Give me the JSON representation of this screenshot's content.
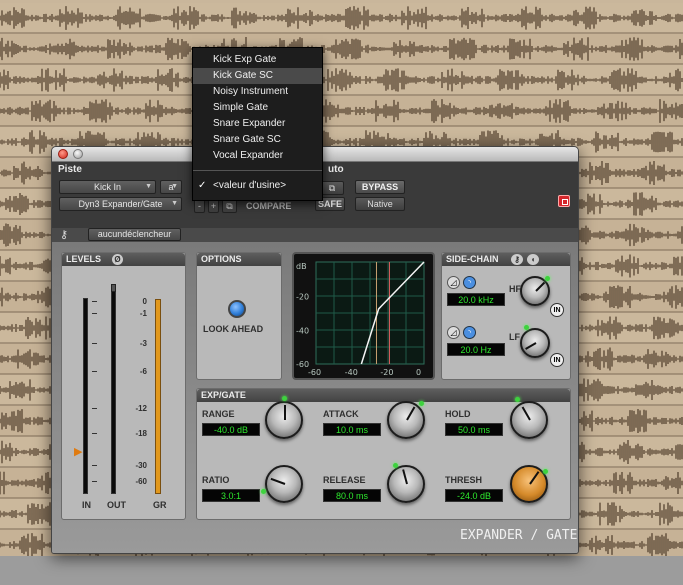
{
  "menu": {
    "items": [
      "Kick Exp Gate",
      "Kick Gate SC",
      "Noisy Instrument",
      "Simple Gate",
      "Snare Expander",
      "Snare Gate SC",
      "Vocal Expander"
    ],
    "highlighted_index": 1,
    "factory_default": "<valeur d'usine>",
    "checkmark": "✓"
  },
  "header": {
    "track_label": "Piste",
    "auto_label": "uto",
    "track_name": "Kick In",
    "track_channel": "a",
    "plugin_name": "Dyn3 Expander/Gate",
    "compare_label": "COMPARE",
    "safe_label": "SAFE",
    "bypass_label": "BYPASS",
    "native_label": "Native",
    "minus_label": "-",
    "plus_label": "+",
    "key_input": "aucundéclencheur"
  },
  "levels": {
    "title": "LEVELS",
    "scale": [
      "0",
      "-1",
      "-3",
      "-6",
      "-12",
      "-18",
      "-30",
      "-60"
    ],
    "in_label": "IN",
    "out_label": "OUT",
    "gr_label": "GR"
  },
  "options": {
    "title": "OPTIONS",
    "look_ahead_label": "LOOK AHEAD"
  },
  "graph": {
    "y_ticks": [
      "dB",
      "-20",
      "-40",
      "-60"
    ],
    "x_ticks": [
      "-60",
      "-40",
      "-20",
      "0"
    ]
  },
  "sidechain": {
    "title": "SIDE-CHAIN",
    "hf_label": "HF",
    "hf_value": "20.0 kHz",
    "lf_label": "LF",
    "lf_value": "20.0 Hz",
    "in_label": "IN"
  },
  "exp_gate": {
    "title": "EXP/GATE",
    "range_label": "RANGE",
    "range_value": "-40.0 dB",
    "attack_label": "ATTACK",
    "attack_value": "10.0 ms",
    "hold_label": "HOLD",
    "hold_value": "50.0 ms",
    "ratio_label": "RATIO",
    "ratio_value": "3.0:1",
    "release_label": "RELEASE",
    "release_value": "80.0 ms",
    "thresh_label": "THRESH",
    "thresh_value": "-24.0 dB"
  },
  "footer_logo": "EXPANDER / GATE",
  "colors": {
    "readout_green": "#2ee82e",
    "thresh_knob": "#d58a2a",
    "look_ahead_led": "#2f7ed8"
  }
}
